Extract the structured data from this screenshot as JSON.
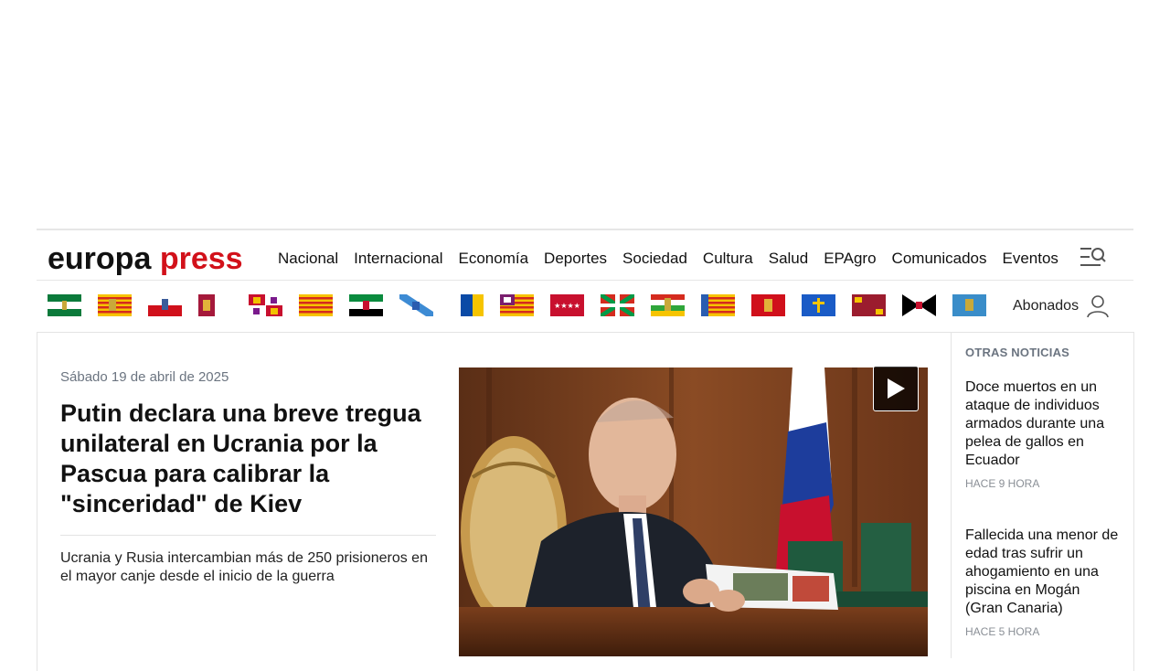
{
  "brand": {
    "word1": "europa",
    "word2": "press"
  },
  "nav": [
    "Nacional",
    "Internacional",
    "Economía",
    "Deportes",
    "Sociedad",
    "Cultura",
    "Salud",
    "EPAgro",
    "Comunicados",
    "Eventos"
  ],
  "regions": [
    "andalucia-flag",
    "aragon-flag",
    "cantabria-flag",
    "castilla-la-mancha-flag",
    "castilla-y-leon-flag",
    "catalunya-flag",
    "extremadura-flag",
    "galicia-flag",
    "canarias-flag",
    "baleares-flag",
    "madrid-flag",
    "euskadi-flag",
    "la-rioja-flag",
    "comunitat-valenciana-flag",
    "navarra-flag",
    "asturias-flag",
    "murcia-flag",
    "ceuta-flag",
    "melilla-flag"
  ],
  "abonados": "Abonados",
  "main": {
    "date": "Sábado 19 de abril de 2025",
    "headline": "Putin declara una breve tregua unilateral en Ucrania por la Pascua para calibrar la \"sinceridad\" de Kiev",
    "related": "Ucrania y Rusia intercambian más de 250 prisioneros en el mayor canje desde el inicio de la guerra"
  },
  "sidebar": {
    "title": "OTRAS NOTICIAS",
    "items": [
      {
        "text": "Doce muertos en un ataque de individuos armados durante una pelea de gallos en Ecuador",
        "time": "HACE 9 HORA"
      },
      {
        "text": "Fallecida una menor de edad tras sufrir un ahogamiento en una piscina en Mogán (Gran Canaria)",
        "time": "HACE 5 HORA"
      }
    ]
  },
  "colors": {
    "brand_red": "#d2111a",
    "muted": "#6b7480"
  }
}
